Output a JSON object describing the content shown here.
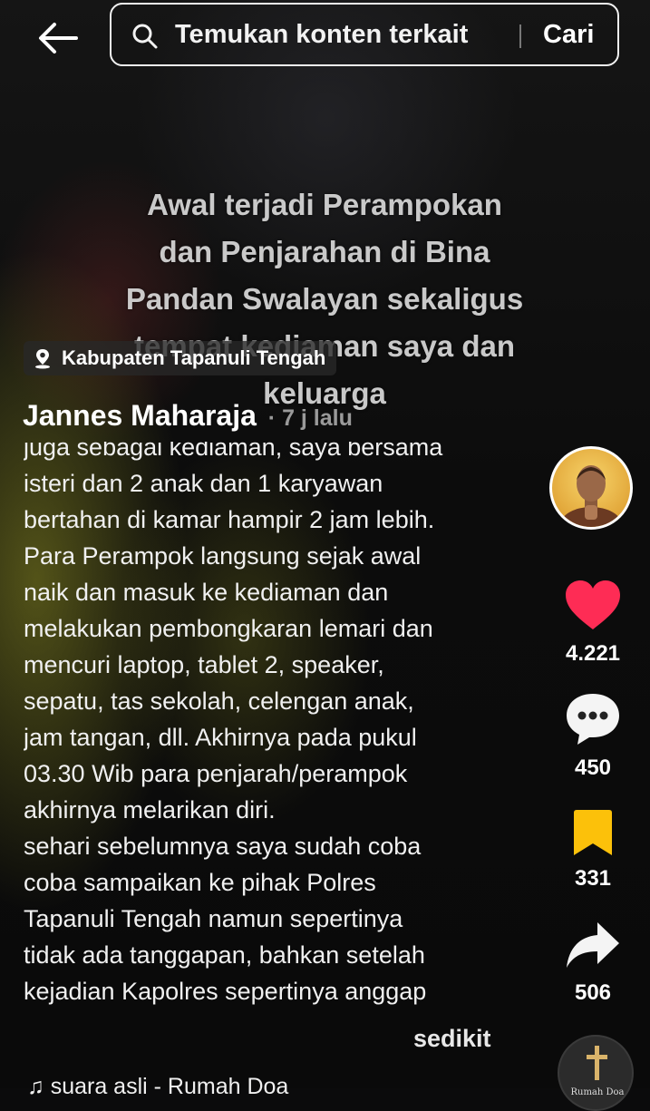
{
  "header": {
    "search_placeholder": "Temukan konten terkait",
    "search_button": "Cari"
  },
  "overlay_caption": [
    "Awal terjadi Perampokan",
    "dan Penjarahan di Bina",
    "Pandan Swalayan sekaligus",
    "tempat kediaman saya dan",
    "keluarga"
  ],
  "location": "Kabupaten Tapanuli Tengah",
  "author": {
    "name": "Jannes Maharaja",
    "time": "· 7 j lalu"
  },
  "description_lines": [
    "juga sebagai kediaman, saya bersama",
    "isteri dan 2 anak dan 1 karyawan",
    "bertahan di kamar hampir 2 jam lebih.",
    "Para Perampok langsung sejak awal",
    "naik dan masuk ke kediaman dan",
    "melakukan pembongkaran lemari dan",
    "mencuri laptop, tablet 2, speaker,",
    "sepatu, tas sekolah, celengan anak,",
    "jam tangan, dll. Akhirnya pada pukul",
    "03.30 Wib para penjarah/perampok",
    "akhirnya melarikan diri.",
    "sehari sebelumnya saya sudah coba",
    "coba sampaikan ke pihak Polres",
    "Tapanuli Tengah namun sepertinya",
    "tidak ada tanggapan, bahkan setelah",
    "kejadian Kapolres sepertinya anggap"
  ],
  "more_label": "sedikit",
  "music_label": "♫ suara asli - Rumah Doa",
  "actions": {
    "likes": "4.221",
    "comments": "450",
    "saves": "331",
    "shares": "506"
  },
  "disc_label": "Rumah Doa",
  "colors": {
    "like": "#fe2c55",
    "save": "#fcc10a"
  }
}
